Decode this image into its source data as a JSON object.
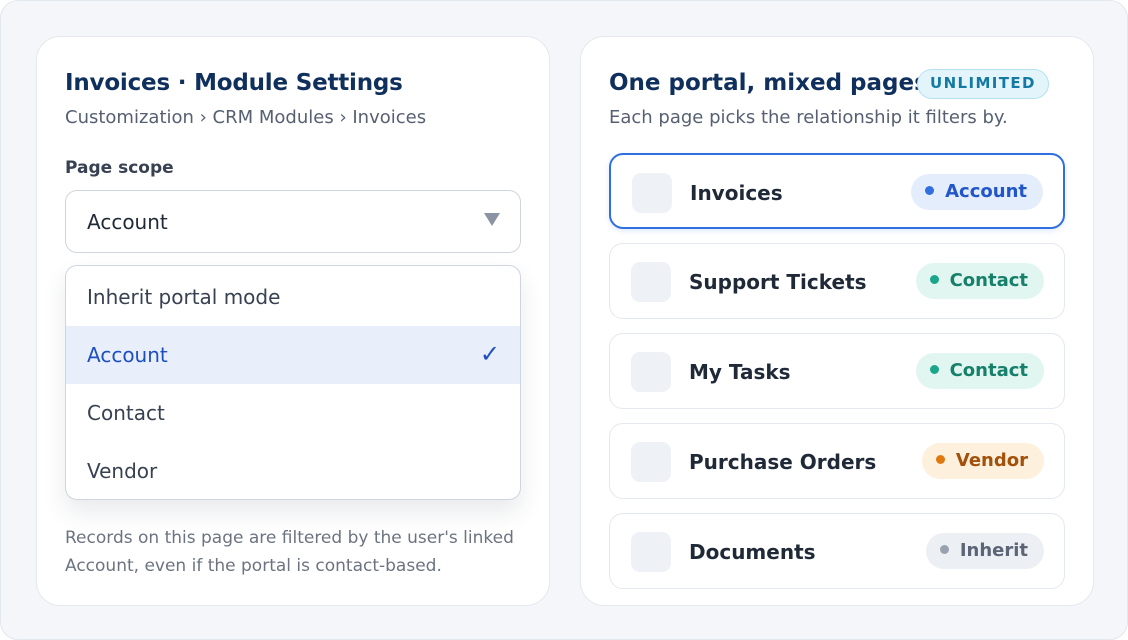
{
  "settings": {
    "title": "Invoices · Module Settings",
    "breadcrumb": "Customization › CRM Modules › Invoices",
    "field_label": "Page scope",
    "selected_value": "Account",
    "options": [
      {
        "label": "Inherit portal mode",
        "selected": false
      },
      {
        "label": "Account",
        "selected": true
      },
      {
        "label": "Contact",
        "selected": false
      },
      {
        "label": "Vendor",
        "selected": false
      }
    ],
    "check_icon": "✓",
    "helper_text": "Records on this page are filtered by the user's linked Account, even if the portal is contact-based."
  },
  "portal": {
    "title": "One portal, mixed pages",
    "badge": "UNLIMITED",
    "subtitle": "Each page picks the relationship it filters by.",
    "pages": [
      {
        "name": "Invoices",
        "scope": "Account",
        "active": true
      },
      {
        "name": "Support Tickets",
        "scope": "Contact",
        "active": false
      },
      {
        "name": "My Tasks",
        "scope": "Contact",
        "active": false
      },
      {
        "name": "Purchase Orders",
        "scope": "Vendor",
        "active": false
      },
      {
        "name": "Documents",
        "scope": "Inherit",
        "active": false
      }
    ]
  },
  "colors": {
    "accent": "#2f6fdf",
    "heading": "#0f2f5c",
    "account": "#2f6fdf",
    "contact": "#1aa68a",
    "vendor": "#e07a10",
    "inherit": "#98a1ae"
  }
}
